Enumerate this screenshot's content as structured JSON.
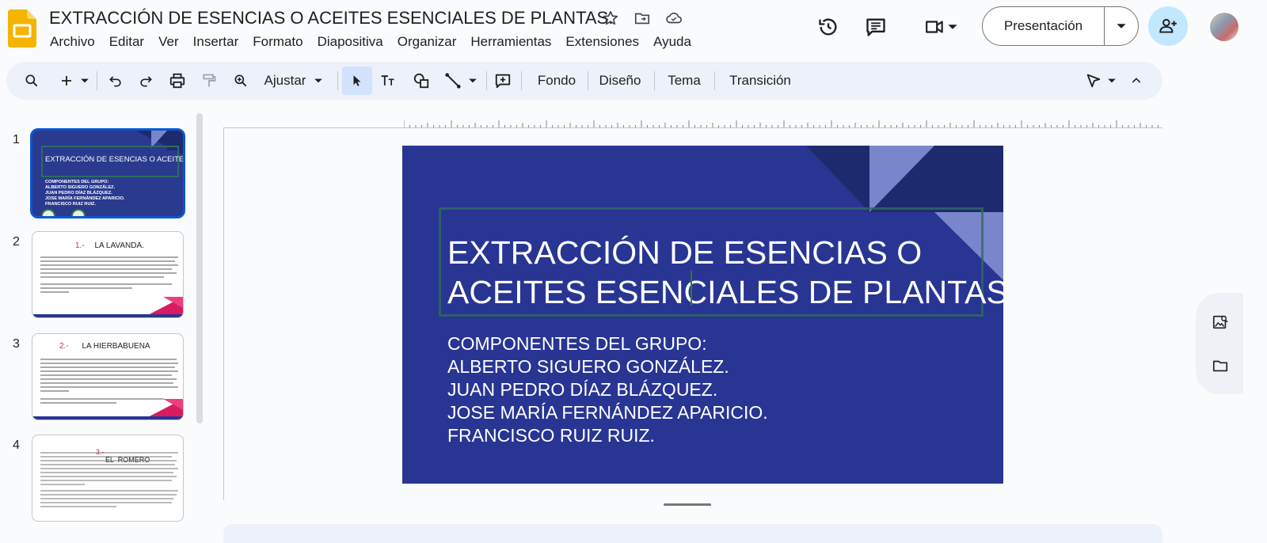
{
  "document": {
    "title": "EXTRACCIÓN DE ESENCIAS O ACEITES ESENCIALES DE PLANTAS."
  },
  "menu": [
    "Archivo",
    "Editar",
    "Ver",
    "Insertar",
    "Formato",
    "Diapositiva",
    "Organizar",
    "Herramientas",
    "Extensiones",
    "Ayuda"
  ],
  "header": {
    "present_label": "Presentación"
  },
  "toolbar": {
    "zoom_label": "Ajustar",
    "background_label": "Fondo",
    "layout_label": "Diseño",
    "theme_label": "Tema",
    "transition_label": "Transición"
  },
  "filmstrip": {
    "numbers": [
      "1",
      "2",
      "3",
      "4"
    ],
    "slide1": {
      "title": "EXTRACCIÓN DE ESENCIAS O ACEITES ESENCIALES DE PLANTAS.",
      "lines": [
        "COMPONENTES DEL GRUPO:",
        "ALBERTO SIGUERO GONZÁLEZ.",
        "JUAN PEDRO DÍAZ BLÁZQUEZ.",
        "JOSE MARÍA FERNÁNDEZ APARICIO.",
        "FRANCISCO RUIZ RUIZ."
      ]
    },
    "slide2": {
      "num": "1.-",
      "title": "LA LAVANDA."
    },
    "slide3": {
      "num": "2.-",
      "title": "LA HIERBABUENA"
    },
    "slide4": {
      "num": "3.-",
      "title": "EL  ROMERO"
    }
  },
  "slide": {
    "title_line1": "EXTRACCIÓN DE ESENCIAS O",
    "title_line2": "ACEITES ESENCIALES DE PLANTAS.",
    "subtitle_lines": [
      "COMPONENTES DEL GRUPO:",
      "ALBERTO SIGUERO GONZÁLEZ.",
      "JUAN PEDRO DÍAZ BLÁZQUEZ.",
      "JOSE MARÍA FERNÁNDEZ APARICIO.",
      "FRANCISCO RUIZ RUIZ."
    ]
  },
  "colors": {
    "slide_bg": "#283593",
    "accent": "#0b57d0",
    "thumb_red": "#d81b60"
  }
}
